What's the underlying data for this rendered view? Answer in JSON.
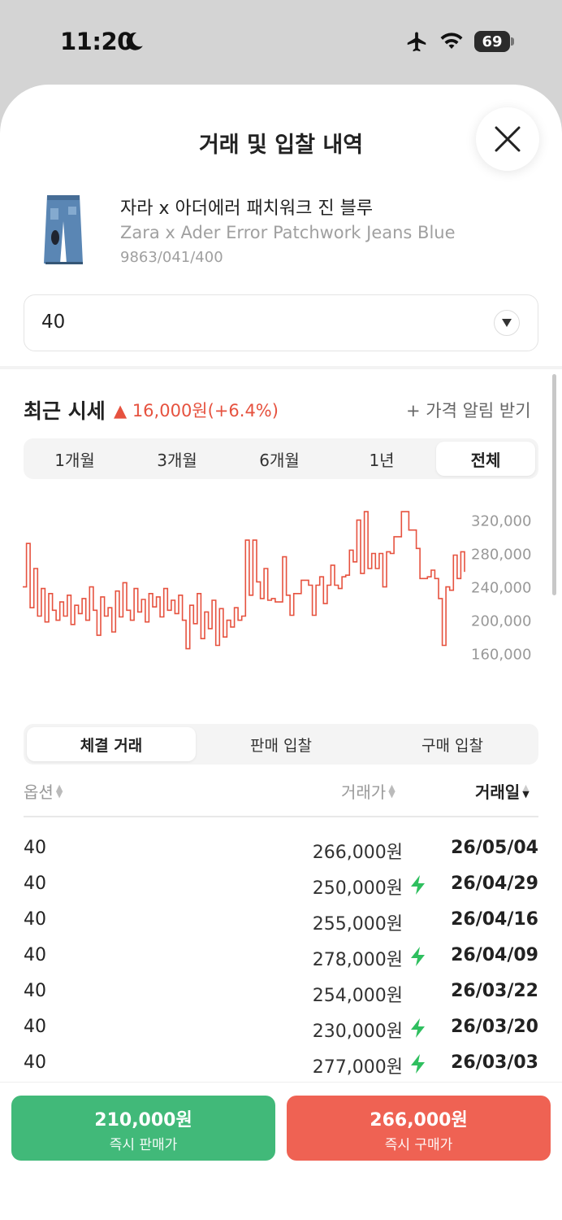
{
  "status": {
    "time": "11:20",
    "battery": "69"
  },
  "sheet": {
    "title": "거래 및 입찰 내역"
  },
  "product": {
    "name_ko": "자라 x 아더에러 패치워크 진 블루",
    "name_en": "Zara x Ader Error Patchwork Jeans Blue",
    "code": "9863/041/400"
  },
  "size_select": {
    "value": "40"
  },
  "market": {
    "label": "최근 시세",
    "change": "▲ 16,000원(+6.4%)",
    "alert_link": "+ 가격 알림 받기",
    "periods": [
      "1개월",
      "3개월",
      "6개월",
      "1년",
      "전체"
    ],
    "active_period": "전체"
  },
  "chart_data": {
    "type": "line",
    "y_ticks": [
      "320,000",
      "280,000",
      "240,000",
      "200,000",
      "160,000"
    ],
    "ylim": [
      150000,
      335000
    ],
    "series": [
      {
        "values": [
          240000,
          292000,
          215000,
          262000,
          205000,
          238000,
          198000,
          232000,
          212000,
          200000,
          222000,
          205000,
          230000,
          195000,
          218000,
          208000,
          226000,
          200000,
          240000,
          212000,
          182000,
          228000,
          205000,
          215000,
          186000,
          235000,
          204000,
          245000,
          212000,
          200000,
          238000,
          210000,
          225000,
          198000,
          232000,
          216000,
          228000,
          204000,
          238000,
          212000,
          224000,
          208000,
          230000,
          200000,
          166000,
          218000,
          196000,
          232000,
          178000,
          210000,
          190000,
          224000,
          170000,
          214000,
          180000,
          200000,
          192000,
          215000,
          200000,
          205000,
          296000,
          230000,
          296000,
          246000,
          226000,
          262000,
          224000,
          226000,
          222000,
          222000,
          276000,
          230000,
          206000,
          232000,
          232000,
          248000,
          248000,
          242000,
          206000,
          242000,
          252000,
          220000,
          242000,
          266000,
          242000,
          238000,
          252000,
          254000,
          284000,
          270000,
          320000,
          256000,
          330000,
          262000,
          280000,
          262000,
          280000,
          240000,
          282000,
          280000,
          300000,
          300000,
          330000,
          330000,
          308000,
          308000,
          286000,
          250000,
          250000,
          252000,
          260000,
          250000,
          226000,
          170000,
          240000,
          236000,
          278000,
          250000,
          282000,
          258000
        ]
      }
    ]
  },
  "trade": {
    "tabs": [
      "체결 거래",
      "판매 입찰",
      "구매 입찰"
    ],
    "active_tab": "체결 거래",
    "headers": {
      "option": "옵션",
      "price": "거래가",
      "date": "거래일"
    },
    "rows": [
      {
        "option": "40",
        "price": "266,000원",
        "date": "26/05/04",
        "quick": false
      },
      {
        "option": "40",
        "price": "250,000원",
        "date": "26/04/29",
        "quick": true
      },
      {
        "option": "40",
        "price": "255,000원",
        "date": "26/04/16",
        "quick": false
      },
      {
        "option": "40",
        "price": "278,000원",
        "date": "26/04/09",
        "quick": true
      },
      {
        "option": "40",
        "price": "254,000원",
        "date": "26/03/22",
        "quick": false
      },
      {
        "option": "40",
        "price": "230,000원",
        "date": "26/03/20",
        "quick": true
      },
      {
        "option": "40",
        "price": "277,000원",
        "date": "26/03/03",
        "quick": true
      }
    ]
  },
  "actions": {
    "sell": {
      "price": "210,000원",
      "label": "즉시 판매가"
    },
    "buy": {
      "price": "266,000원",
      "label": "즉시 구매가"
    }
  },
  "colors": {
    "up": "#e6523f",
    "sell": "#41b979",
    "buy": "#ef6253",
    "bolt": "#2fbf5f"
  }
}
